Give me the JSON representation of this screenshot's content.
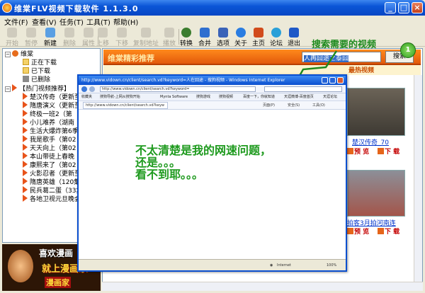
{
  "window": {
    "title": "维棠FLV视频下载软件  1.1.3.0",
    "minimize": "_",
    "maximize": "□",
    "close": "×"
  },
  "menu": [
    "文件(F)",
    "查看(V)",
    "任务(T)",
    "工具(T)",
    "帮助(H)"
  ],
  "toolbar": [
    {
      "label": "开始",
      "enabled": false,
      "color": "#bbb"
    },
    {
      "label": "暂停",
      "enabled": false,
      "color": "#bbb"
    },
    {
      "label": "新建",
      "enabled": true,
      "color": "#5a9fe3"
    },
    {
      "label": "删除",
      "enabled": false,
      "color": "#bbb"
    },
    {
      "label": "属性",
      "enabled": false,
      "color": "#bbb"
    },
    {
      "label": "上移",
      "enabled": false,
      "color": "#bbb"
    },
    {
      "label": "下移",
      "enabled": false,
      "color": "#bbb"
    },
    {
      "label": "复制地址",
      "enabled": false,
      "color": "#bbb"
    },
    {
      "label": "播放",
      "enabled": false,
      "color": "#bbb"
    },
    {
      "label": "转换",
      "enabled": true,
      "color": "#3b7d2e"
    },
    {
      "label": "合并",
      "enabled": true,
      "color": "#2f6fcf"
    },
    {
      "label": "选项",
      "enabled": true,
      "color": "#3a63b8"
    },
    {
      "label": "关于",
      "enabled": true,
      "color": "#2a7de1"
    },
    {
      "label": "主页",
      "enabled": true,
      "color": "#d14b1b"
    },
    {
      "label": "论坛",
      "enabled": true,
      "color": "#2aa0d8"
    },
    {
      "label": "退出",
      "enabled": true,
      "color": "#1f59c7"
    }
  ],
  "tree": {
    "root": "维棠",
    "items": [
      "正在下载",
      "已下载",
      "已删除"
    ],
    "hot_root": "【热门视频推荐】",
    "hot_items": [
      "楚汉传奇（更新至",
      "隋唐演义（更新至",
      "终极一班2（第",
      "小儿难养（湖南",
      "生活大爆炸第6季",
      "我是歌手（第02",
      "天天向上（第02",
      "本山带徒上春晚（",
      "康熙来了（第02",
      "火影忍者（更新至",
      "隋唐英雄（120集",
      "民兵葛二蛋（33集",
      "各地卫视元旦晚会"
    ]
  },
  "ad": {
    "line1": "喜欢漫画",
    "line2": "就上漫画家",
    "line3": "漫画家"
  },
  "site": {
    "banner": "维棠精彩推荐",
    "subhead": "最热视频"
  },
  "search": {
    "value": "人再囧途之泰囧",
    "button": "搜索"
  },
  "annotation": {
    "text": "搜索需要的视频",
    "marker": "1"
  },
  "videos": [
    {
      "title": "楚汉传奇_70",
      "preview": "预 览",
      "download": "下 载"
    },
    {
      "title": "拍客3月拍河南连",
      "preview": "预 览",
      "download": "下 载"
    }
  ],
  "ie": {
    "title": "http://www.vidown.cn/client/search.vd?keyword=人在囧途 - 搜狗视频 - Windows Internet Explorer",
    "url": "http://www.vidown.cn/client/search.vd?keyword=",
    "favorites": [
      "收藏夹",
      "搜狗导航-上网从搜狗开始",
      "Mynta Software",
      "搜狗游戏",
      "搜狗视频",
      "百度一下，你就知道",
      "天涯微博-百度首页",
      "天涯论坛"
    ],
    "tab": "http://www.vidown.cn/client/search.vd?keyw",
    "tab_tools": [
      "页面(P)",
      "安全(S)",
      "工具(O)"
    ],
    "message": [
      "不太清楚是我的网速问题，",
      "还是。。。",
      "看不到耶。。。"
    ],
    "status_zone": "Internet",
    "status_zoom": "100%"
  }
}
